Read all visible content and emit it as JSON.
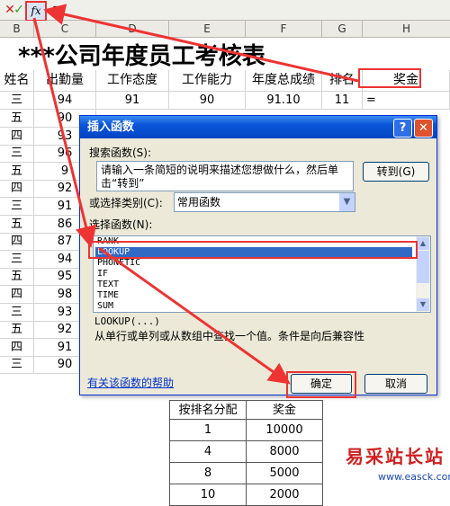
{
  "formula_bar": {
    "cancel": "✕",
    "enter": "✓",
    "fx": "fx",
    "formula": "="
  },
  "sheet": {
    "columns": [
      "B",
      "C",
      "D",
      "E",
      "F",
      "G",
      "H"
    ],
    "title": "***公司年度员工考核表",
    "headers": [
      "姓名",
      "出勤量",
      "工作态度",
      "工作能力",
      "年度总成绩",
      "排名",
      "奖金"
    ],
    "row1": {
      "name": "三",
      "attendance": "94",
      "attitude": "91",
      "ability": "90",
      "total": "91.10",
      "rank": "11",
      "bonus": "="
    },
    "names": [
      "五",
      "四",
      "三",
      "五",
      "四",
      "三",
      "五",
      "四",
      "三",
      "五",
      "四",
      "三",
      "五",
      "四",
      "三"
    ],
    "attendance": [
      "90",
      "93",
      "96",
      "9",
      "92",
      "91",
      "86",
      "87",
      "94",
      "95",
      "98",
      "93",
      "92",
      "91",
      "90"
    ]
  },
  "dialog": {
    "title": "插入函数",
    "help_glyph": "?",
    "close_glyph": "✕",
    "search_label": "搜索函数(S):",
    "search_text": "请输入一条简短的说明来描述您想做什么，然后单击“转到”",
    "go_button": "转到(G)",
    "category_label": "或选择类别(C):",
    "category_value": "常用函数",
    "select_label": "选择函数(N):",
    "functions": [
      "RANK",
      "LOOKUP",
      "PHONETIC",
      "IF",
      "TEXT",
      "TIME",
      "SUM"
    ],
    "selected_index": 1,
    "func_signature": "LOOKUP(...)",
    "func_desc": "从单行或单列或从数组中查找一个值。条件是向后兼容性",
    "help_link": "有关该函数的帮助",
    "ok": "确定",
    "cancel": "取消"
  },
  "bonus_table": {
    "headers": [
      "按排名分配",
      "奖金"
    ],
    "rows": [
      [
        "1",
        "10000"
      ],
      [
        "4",
        "8000"
      ],
      [
        "8",
        "5000"
      ],
      [
        "10",
        "2000"
      ]
    ]
  },
  "watermark": {
    "title": "易采站长站",
    "url": "www.easck.com"
  },
  "colors": {
    "accent_red": "#e33333",
    "dialog_title": "#0a55d8",
    "selection": "#316ac5"
  }
}
